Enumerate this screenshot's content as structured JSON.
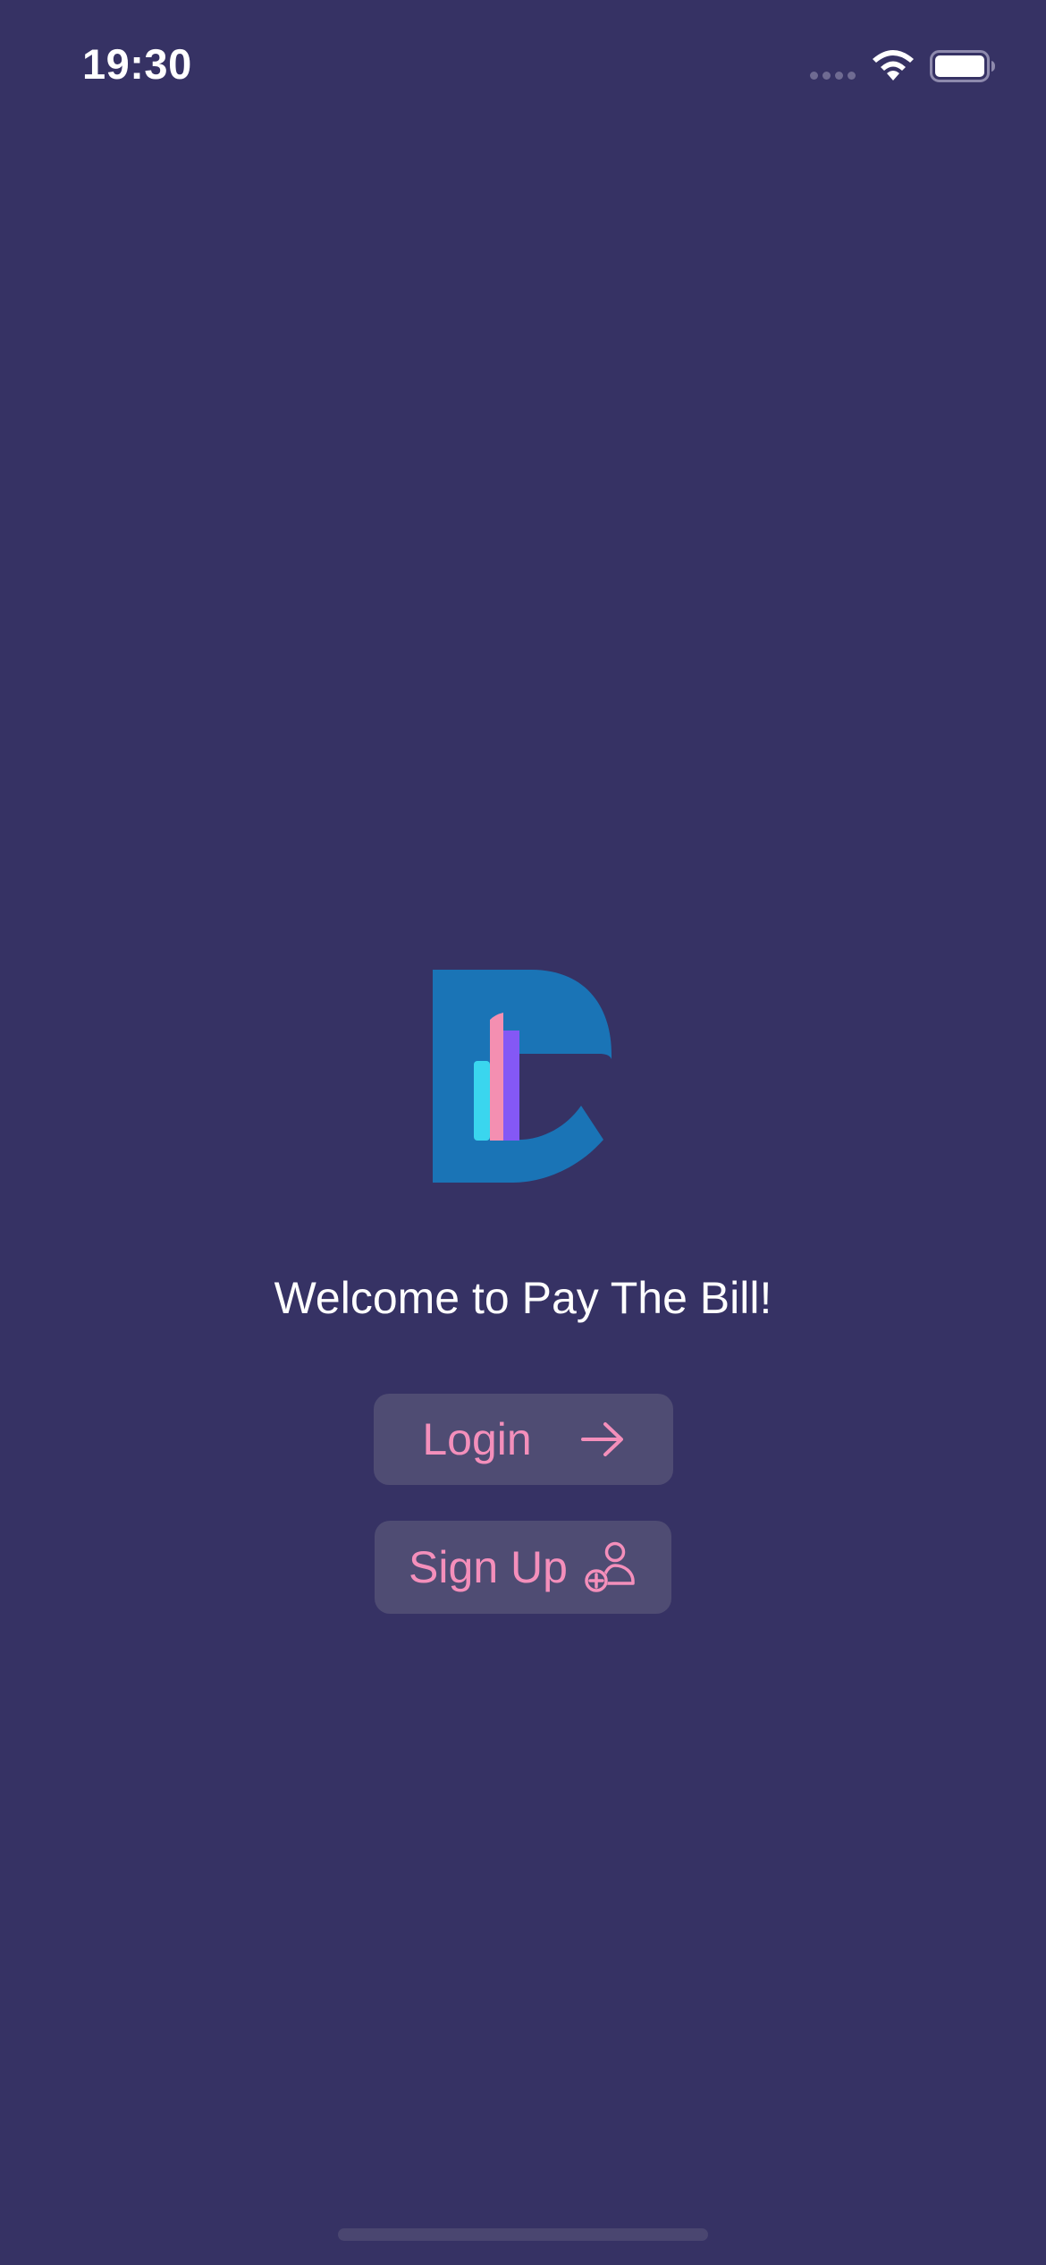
{
  "status_bar": {
    "time": "19:30"
  },
  "app": {
    "logo_icon": "pay-the-bill-logo",
    "logo_colors": [
      "#1a74b6",
      "#3ad6ee",
      "#f48fb1",
      "#8458f5"
    ]
  },
  "welcome": {
    "text": "Welcome to Pay The Bill!"
  },
  "buttons": {
    "login_label": "Login",
    "login_icon": "arrow-right-icon",
    "signup_label": "Sign Up",
    "signup_icon": "add-user-icon"
  },
  "colors": {
    "background": "#363264",
    "button_background": "#4f4c73",
    "accent": "#f48fbb",
    "text": "#ffffff"
  }
}
